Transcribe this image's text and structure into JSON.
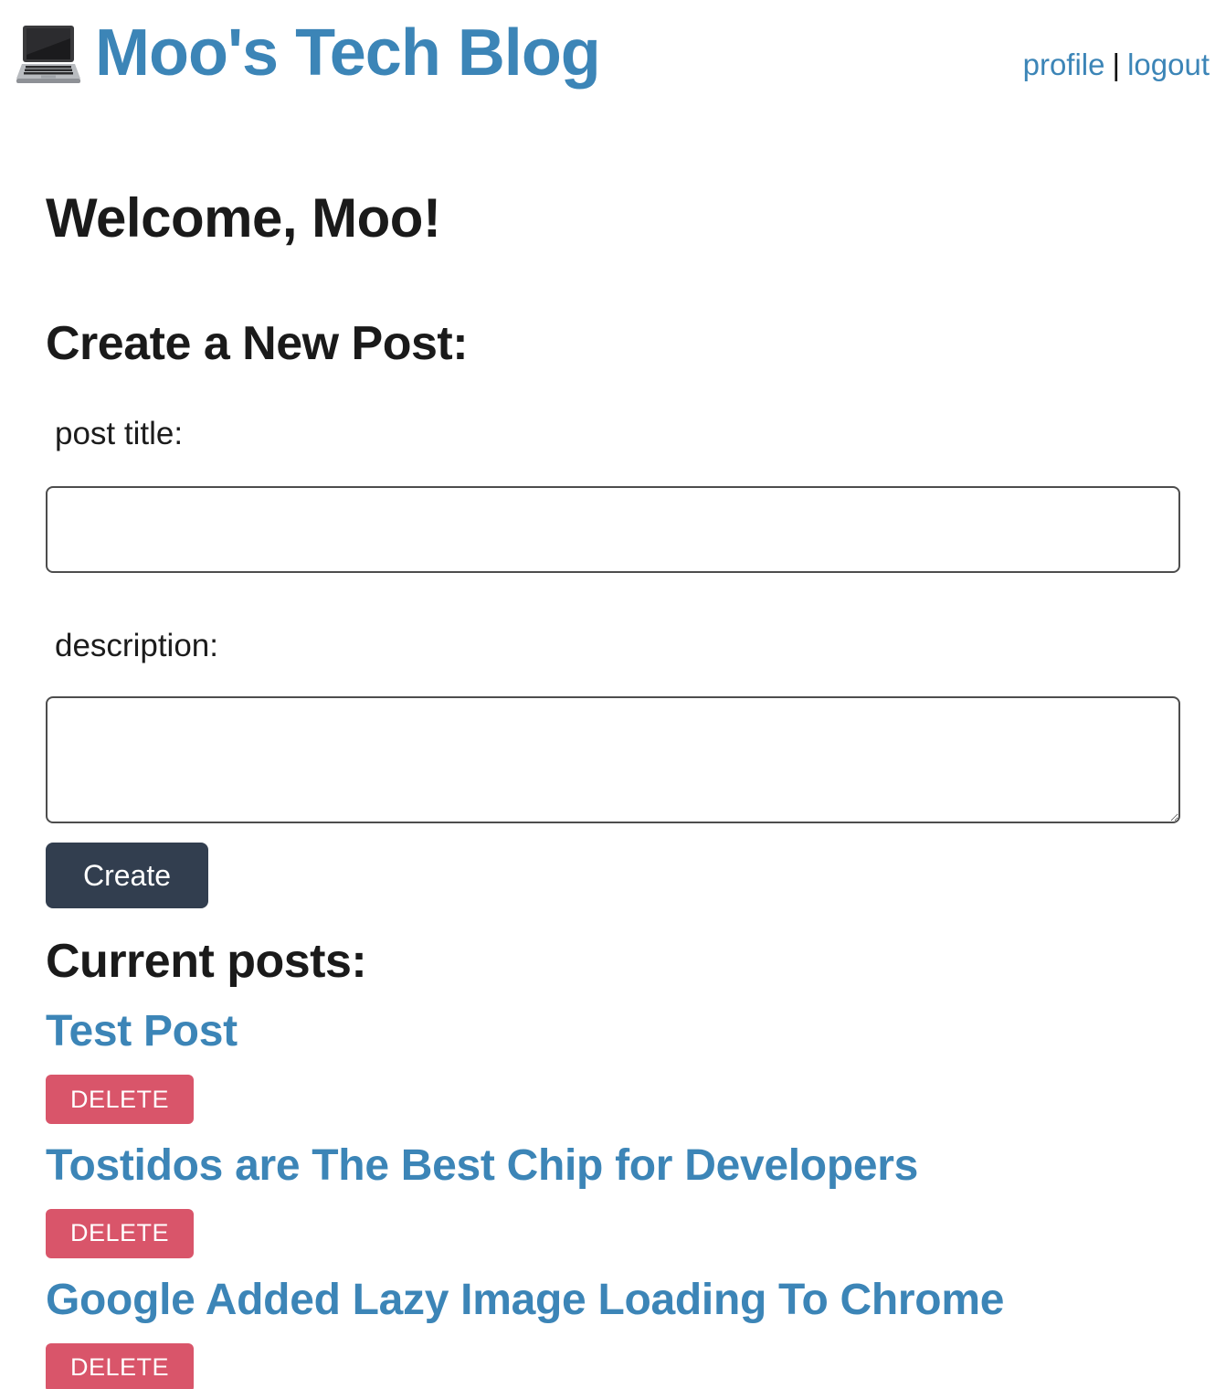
{
  "header": {
    "icon": "laptop-icon",
    "title": "Moo's Tech Blog",
    "nav": {
      "profile": "profile",
      "separator": "|",
      "logout": "logout"
    }
  },
  "main": {
    "welcome": "Welcome, Moo!",
    "create_section_title": "Create a New Post:",
    "form": {
      "title_label": "post title:",
      "title_value": "",
      "description_label": "description:",
      "description_value": "",
      "submit_label": "Create"
    },
    "posts_section_title": "Current posts:",
    "posts": [
      {
        "title": "Test Post",
        "delete_label": "DELETE"
      },
      {
        "title": "Tostidos are The Best Chip for Developers",
        "delete_label": "DELETE"
      },
      {
        "title": "Google Added Lazy Image Loading To Chrome",
        "delete_label": "DELETE"
      }
    ]
  },
  "colors": {
    "link": "#3c85b7",
    "create_button": "#323e4f",
    "delete_button": "#d9556a",
    "heading_text": "#1a1a1a"
  }
}
